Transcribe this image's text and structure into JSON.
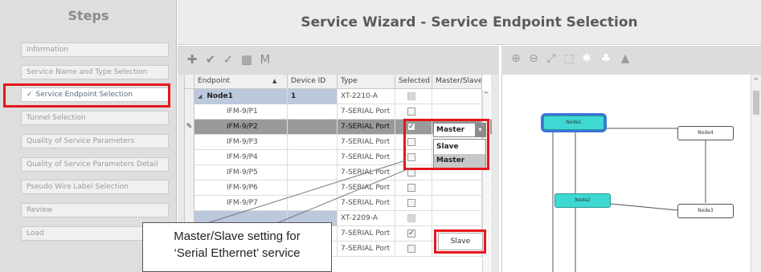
{
  "sidebar": {
    "title": "Steps",
    "items": [
      {
        "label": "Information",
        "active": false
      },
      {
        "label": "Service Name and Type Selection",
        "active": false
      },
      {
        "label": "Service Endpoint Selection",
        "active": true
      },
      {
        "label": "Tunnel Selection",
        "active": false
      },
      {
        "label": "Quality of Service Parameters",
        "active": false
      },
      {
        "label": "Quality of Service Parameters Detail",
        "active": false
      },
      {
        "label": "Pseudo Wire Label Selection",
        "active": false
      },
      {
        "label": "Review",
        "active": false
      },
      {
        "label": "Load",
        "active": false
      }
    ],
    "active_check": "✓"
  },
  "title": "Service Wizard - Service Endpoint Selection",
  "table": {
    "headers": {
      "endpoint": "Endpoint",
      "device_id": "Device ID",
      "type": "Type",
      "selected": "Selected",
      "master_slave": "Master/Slave"
    },
    "sort_indicator": "▲",
    "rows": [
      {
        "endpoint": "Node1",
        "device_id": "1",
        "type": "XT-2210-A",
        "selected": "dim",
        "role": "",
        "kind": "node",
        "expander": "◢"
      },
      {
        "endpoint": "IFM-9/P1",
        "device_id": "",
        "type": "7-SERIAL Port",
        "selected": "off",
        "role": "",
        "kind": "port"
      },
      {
        "endpoint": "IFM-9/P2",
        "device_id": "",
        "type": "7-SERIAL Port",
        "selected": "on",
        "role": "",
        "kind": "port-selected"
      },
      {
        "endpoint": "IFM-9/P3",
        "device_id": "",
        "type": "7-SERIAL Port",
        "selected": "off",
        "role": "",
        "kind": "port"
      },
      {
        "endpoint": "IFM-9/P4",
        "device_id": "",
        "type": "7-SERIAL Port",
        "selected": "off",
        "role": "",
        "kind": "port"
      },
      {
        "endpoint": "IFM-9/P5",
        "device_id": "",
        "type": "7-SERIAL Port",
        "selected": "off",
        "role": "",
        "kind": "port"
      },
      {
        "endpoint": "IFM-9/P6",
        "device_id": "",
        "type": "7-SERIAL Port",
        "selected": "off",
        "role": "",
        "kind": "port"
      },
      {
        "endpoint": "IFM-9/P7",
        "device_id": "",
        "type": "7-SERIAL Port",
        "selected": "off",
        "role": "",
        "kind": "port"
      },
      {
        "endpoint": "",
        "device_id": "",
        "type": "XT-2209-A",
        "selected": "dim",
        "role": "",
        "kind": "node"
      },
      {
        "endpoint": "",
        "device_id": "",
        "type": "7-SERIAL Port",
        "selected": "on",
        "role": "Slave",
        "kind": "port"
      },
      {
        "endpoint": "",
        "device_id": "",
        "type": "7-SERIAL Port",
        "selected": "off",
        "role": "",
        "kind": "port"
      }
    ],
    "edit_marker": "✎",
    "check_glyph": "✓"
  },
  "dropdown": {
    "value": "Master",
    "arrow": "▾",
    "options": [
      {
        "label": "Slave",
        "highlighted": false
      },
      {
        "label": "Master",
        "highlighted": true
      }
    ]
  },
  "callout": {
    "line1": "Master/Slave setting for",
    "line2": "‘Serial Ethernet’ service"
  },
  "diagram": {
    "nodes": [
      {
        "label": "Node1",
        "style": "teal",
        "selected": true
      },
      {
        "label": "Node4",
        "style": "plain",
        "selected": false
      },
      {
        "label": "Node2",
        "style": "teal",
        "selected": false
      },
      {
        "label": "Node3",
        "style": "plain",
        "selected": false
      }
    ]
  },
  "colors": {
    "highlight_red": "#e8151b",
    "node_teal": "#3fd8d2",
    "selection_blue": "#3b74d8"
  }
}
